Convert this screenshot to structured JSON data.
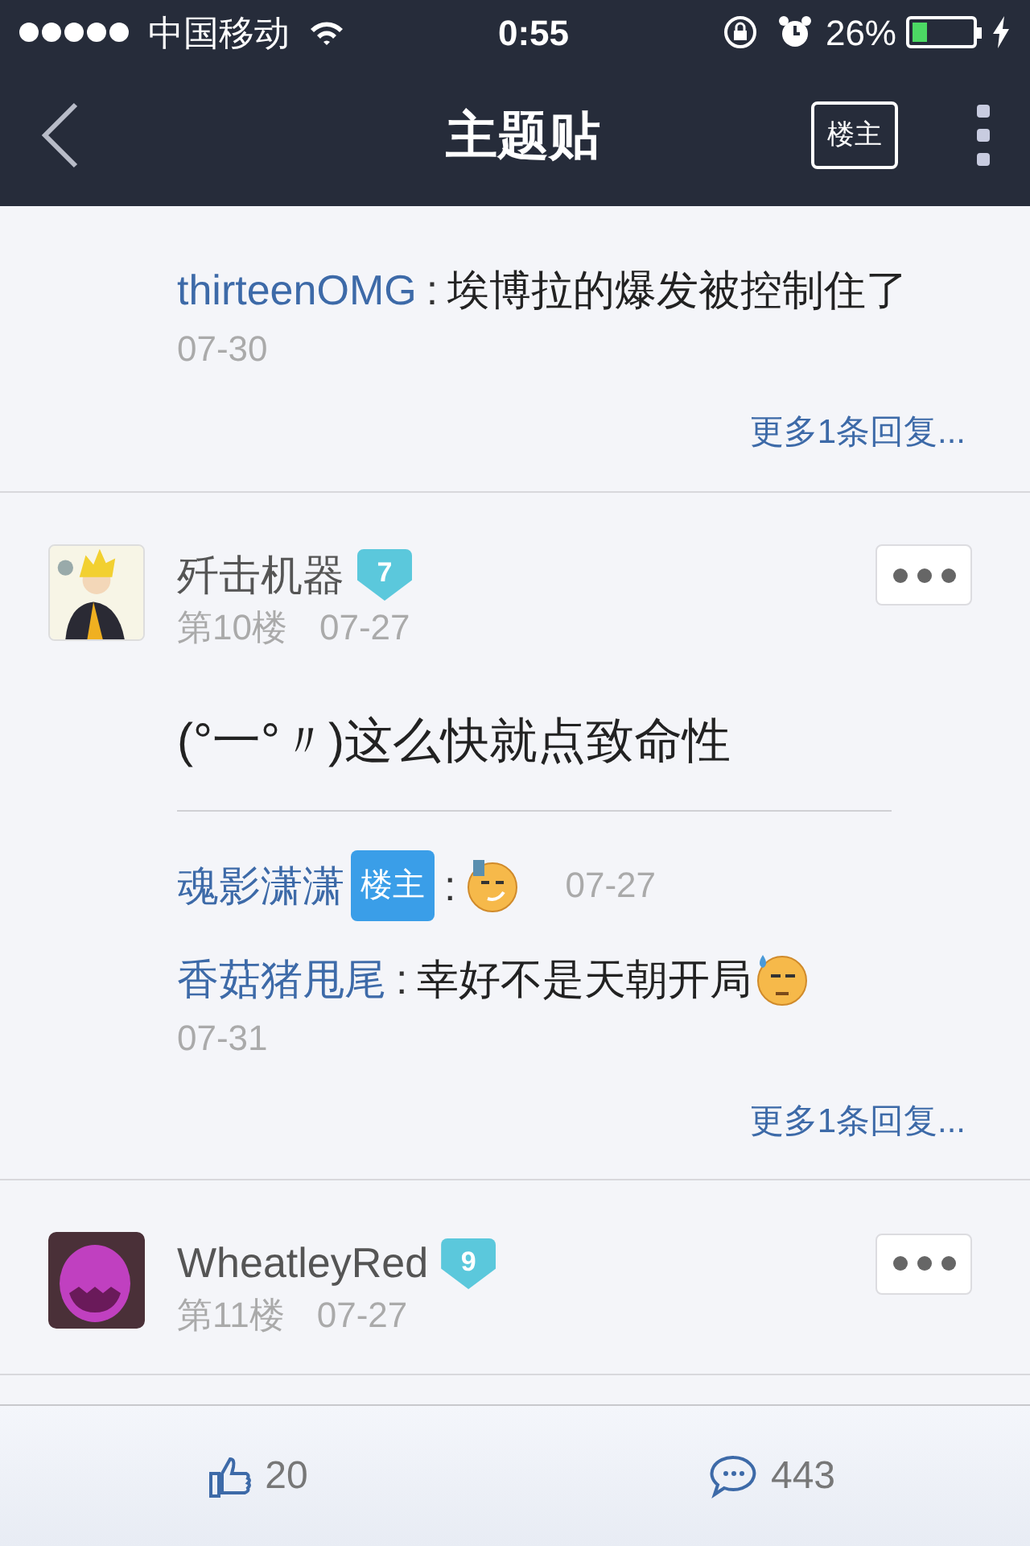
{
  "status_bar": {
    "carrier": "中国移动",
    "time": "0:55",
    "battery": "26%"
  },
  "nav": {
    "title": "主题贴",
    "filter_button": "楼主"
  },
  "top_replies": [
    {
      "user": "thirteenOMG",
      "is_op": false,
      "separator": ":",
      "text": "埃博拉的爆发被控制住了",
      "date": "07-30",
      "kind": "long"
    }
  ],
  "top_more": "更多1条回复...",
  "posts": [
    {
      "user": "歼击机器",
      "level": "7",
      "floor": "第10楼",
      "date": "07-27",
      "avatar": {
        "kind": "figure"
      },
      "body": "(°一°〃)这么快就点致命性",
      "replies": [
        {
          "user": "魂影潇潇",
          "is_op": true,
          "op_label": "楼主",
          "separator": ":",
          "emoticon": {
            "kind": "smirk"
          },
          "date": "07-27",
          "kind": "short"
        },
        {
          "user": "香菇猪甩尾",
          "is_op": false,
          "separator": ":",
          "text": "幸好不是天朝开局",
          "emoticon": {
            "kind": "sweat"
          },
          "date": "07-31",
          "kind": "long"
        }
      ],
      "more": "更多1条回复..."
    },
    {
      "user": "WheatleyRed",
      "level": "9",
      "floor": "第11楼",
      "date": "07-27",
      "avatar": {
        "kind": "creature"
      }
    }
  ],
  "bottom_bar": {
    "likes": "20",
    "comments": "443"
  }
}
